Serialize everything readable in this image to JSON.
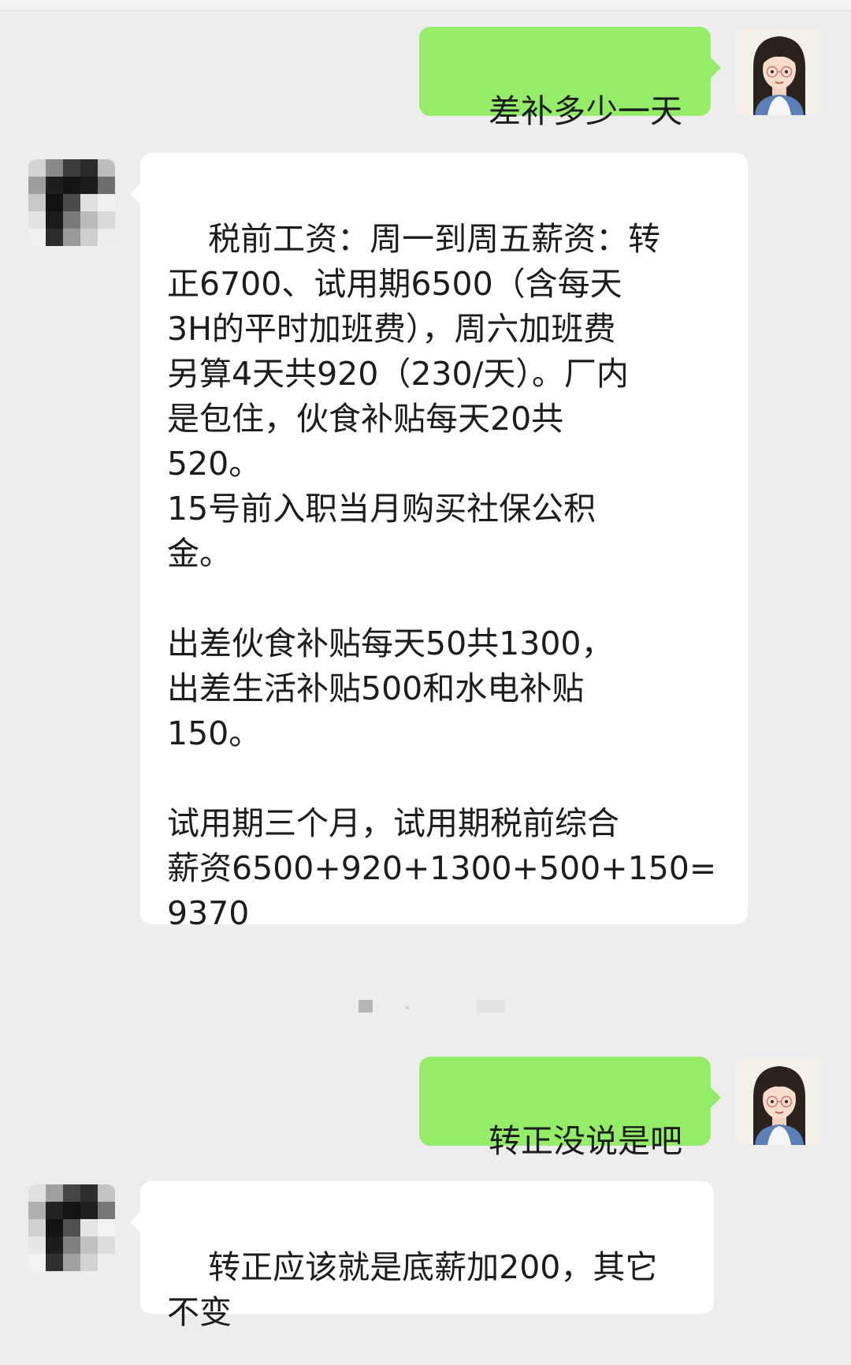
{
  "messages": [
    {
      "sender": "me",
      "text": "差补多少一天",
      "avatar": "girl-avatar-icon"
    },
    {
      "sender": "other",
      "text": "税前工资：周一到周五薪资：转\n正6700、试用期6500（含每天\n3H的平时加班费），周六加班费\n另算4天共920（230/天）。厂内\n是包住，伙食补贴每天20共\n520。\n15号前入职当月购买社保公积\n金。\n\n出差伙食补贴每天50共1300，\n出差生活补贴500和水电补贴\n150。\n\n试用期三个月，试用期税前综合\n薪资6500+920+1300+500+150=\n9370",
      "avatar": "pixelated-avatar-icon"
    },
    {
      "sender": "me",
      "text": "转正没说是吧",
      "avatar": "girl-avatar-icon"
    },
    {
      "sender": "other",
      "text": "转正应该就是底薪加200，其它\n不变",
      "avatar": "pixelated-avatar-icon"
    }
  ],
  "colors": {
    "background": "#ededed",
    "my_bubble": "#95ec69",
    "other_bubble": "#ffffff"
  }
}
